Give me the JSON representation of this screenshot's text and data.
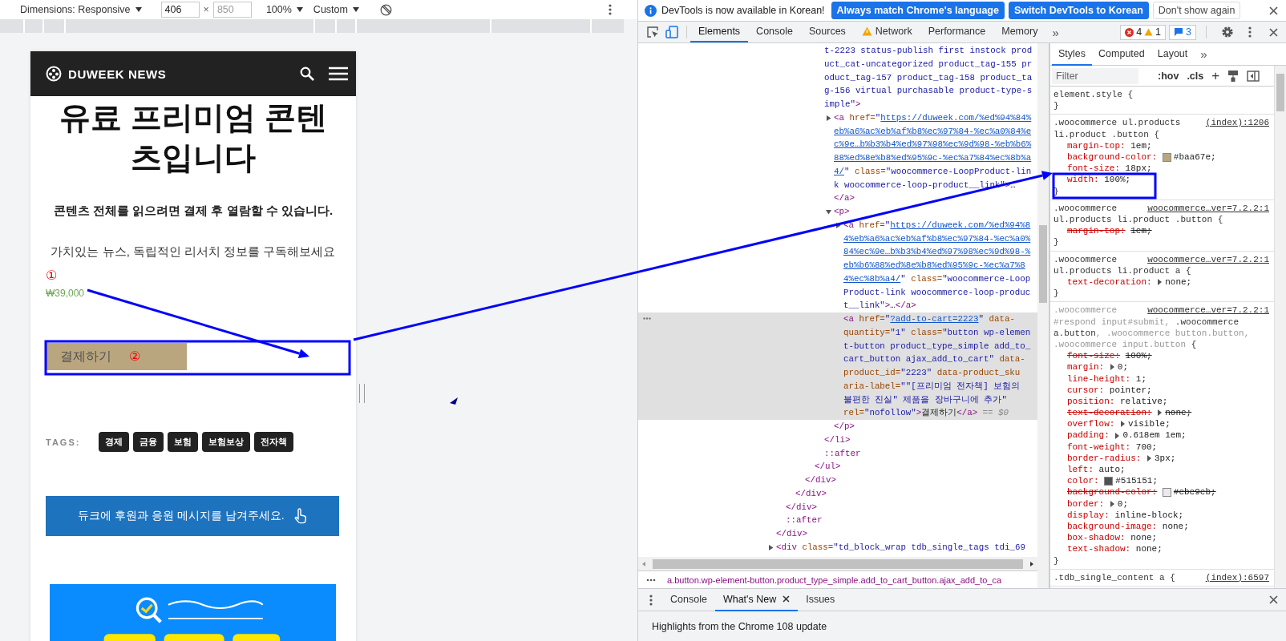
{
  "device_toolbar": {
    "dimensions_label": "Dimensions: Responsive",
    "width_value": "406",
    "times": "×",
    "height_placeholder": "850",
    "zoom": "100%",
    "throttle": "Custom"
  },
  "mobile_page": {
    "brand": "DUWEEK NEWS",
    "title": "유료 프리미엄 콘텐츠입니다",
    "notice": "콘텐츠 전체를 읽으려면 결제 후 열람할 수 있습니다.",
    "subscribe_text": "가치있는 뉴스, 독립적인 리서치 정보를 구독해보세요",
    "price_marker": "①",
    "price": "₩39,000",
    "buy_button": "결제하기",
    "buy_marker": "②",
    "tags_label": "TAGS:",
    "tags": [
      "경제",
      "금융",
      "보험",
      "보험보상",
      "전자책"
    ],
    "support_button": "듀크에 후원과 응원 메시지를 남겨주세요.",
    "banner": {
      "kind": "picture"
    }
  },
  "devtools": {
    "infobar": {
      "message": "DevTools is now available in Korean!",
      "buttons": [
        {
          "label": "Always match Chrome's language",
          "kind": "primary"
        },
        {
          "label": "Switch DevTools to Korean",
          "kind": "primary"
        },
        {
          "label": "Don't show again",
          "kind": "secondary"
        }
      ]
    },
    "device_mode_on": true,
    "tabs": [
      {
        "label": "Elements",
        "selected": true,
        "warning": false
      },
      {
        "label": "Console",
        "selected": false,
        "warning": false
      },
      {
        "label": "Sources",
        "selected": false,
        "warning": false
      },
      {
        "label": "Network",
        "selected": false,
        "warning": true
      },
      {
        "label": "Performance",
        "selected": false,
        "warning": false
      },
      {
        "label": "Memory",
        "selected": false,
        "warning": false
      }
    ],
    "more_tabs": "»",
    "issues": {
      "errors": "4",
      "warnings": "1",
      "messages": "3"
    },
    "dom_tree": [
      {
        "selected": false,
        "children": [
          {
            "selected": false,
            "children": [
              {
                "selected": false,
                "children": [
                  {
                    "selected": false,
                    "children": [
                      {
                        "selected": false,
                        "children": [
                          {
                            "selected": false,
                            "lines": [
                              [
                                {
                                  "kind": "value",
                                  "text": "t-2223 status-publish first instock prod"
                                }
                              ],
                              [
                                {
                                  "kind": "value",
                                  "text": "uct_cat-uncategorized product_tag-155 pr"
                                }
                              ],
                              [
                                {
                                  "kind": "value",
                                  "text": "oduct_tag-157 product_tag-158 product_ta"
                                }
                              ],
                              [
                                {
                                  "kind": "value",
                                  "text": "g-156 virtual purchasable product-type-s"
                                }
                              ],
                              [
                                {
                                  "kind": "value",
                                  "text": "imple\""
                                },
                                {
                                  "kind": "tag",
                                  "text": ">"
                                }
                              ]
                            ],
                            "children": [
                              {
                                "selected": false,
                                "expanded": false,
                                "lines": [
                                  [
                                    {
                                      "kind": "tag",
                                      "text": "<a"
                                    },
                                    {
                                      "kind": "attr",
                                      "text": " href="
                                    },
                                    {
                                      "kind": "value",
                                      "text": "\""
                                    },
                                    {
                                      "kind": "link",
                                      "text": "https://duweek.com/%ed%94%84%"
                                    }
                                  ],
                                  [
                                    {
                                      "kind": "link",
                                      "text": "eb%a6%ac%eb%af%b8%ec%97%84-%ec%a0%84%e"
                                    }
                                  ],
                                  [
                                    {
                                      "kind": "link",
                                      "text": "c%9e…b%b3%b4%ed%97%98%ec%9d%98-%eb%b6%"
                                    }
                                  ],
                                  [
                                    {
                                      "kind": "link",
                                      "text": "88%ed%8e%b8%ed%95%9c-%ec%a7%84%ec%8b%a"
                                    }
                                  ],
                                  [
                                    {
                                      "kind": "link",
                                      "text": "4/"
                                    },
                                    {
                                      "kind": "value",
                                      "text": "\""
                                    },
                                    {
                                      "kind": "attr",
                                      "text": " class="
                                    },
                                    {
                                      "kind": "value",
                                      "text": "\"woocommerce-LoopProduct-lin"
                                    }
                                  ],
                                  [
                                    {
                                      "kind": "value",
                                      "text": "k woocommerce-loop-product__link\""
                                    },
                                    {
                                      "kind": "tag",
                                      "text": ">"
                                    },
                                    {
                                      "kind": "text",
                                      "text": "…"
                                    }
                                  ]
                                ],
                                "close": [
                                  {
                                    "kind": "tag",
                                    "text": "</a>"
                                  }
                                ]
                              },
                              {
                                "selected": false,
                                "expanded": true,
                                "lines": [
                                  [
                                    {
                                      "kind": "tag",
                                      "text": "<p>"
                                    }
                                  ]
                                ],
                                "children": [
                                  {
                                    "selected": false,
                                    "expanded": false,
                                    "lines": [
                                      [
                                        {
                                          "kind": "tag",
                                          "text": "<a"
                                        },
                                        {
                                          "kind": "attr",
                                          "text": " href="
                                        },
                                        {
                                          "kind": "value",
                                          "text": "\""
                                        },
                                        {
                                          "kind": "link",
                                          "text": "https://duweek.com/%ed%94%8"
                                        }
                                      ],
                                      [
                                        {
                                          "kind": "link",
                                          "text": "4%eb%a6%ac%eb%af%b8%ec%97%84-%ec%a0%"
                                        }
                                      ],
                                      [
                                        {
                                          "kind": "link",
                                          "text": "84%ec%9e…b%b3%b4%ed%97%98%ec%9d%98-%"
                                        }
                                      ],
                                      [
                                        {
                                          "kind": "link",
                                          "text": "eb%b6%88%ed%8e%b8%ed%95%9c-%ec%a7%8"
                                        }
                                      ],
                                      [
                                        {
                                          "kind": "link",
                                          "text": "4%ec%8b%a4/"
                                        },
                                        {
                                          "kind": "value",
                                          "text": "\""
                                        },
                                        {
                                          "kind": "attr",
                                          "text": " class="
                                        },
                                        {
                                          "kind": "value",
                                          "text": "\"woocommerce-Loop"
                                        }
                                      ],
                                      [
                                        {
                                          "kind": "value",
                                          "text": "Product-link woocommerce-loop-produc"
                                        }
                                      ],
                                      [
                                        {
                                          "kind": "value",
                                          "text": "t__link\""
                                        },
                                        {
                                          "kind": "tag",
                                          "text": ">"
                                        },
                                        {
                                          "kind": "text",
                                          "text": "…"
                                        },
                                        {
                                          "kind": "tag",
                                          "text": "</a>"
                                        }
                                      ]
                                    ]
                                  },
                                  {
                                    "selected": true,
                                    "lines": [
                                      [
                                        {
                                          "kind": "tag",
                                          "text": "<a"
                                        },
                                        {
                                          "kind": "attr",
                                          "text": " href="
                                        },
                                        {
                                          "kind": "value",
                                          "text": "\""
                                        },
                                        {
                                          "kind": "link",
                                          "text": "?add-to-cart=2223"
                                        },
                                        {
                                          "kind": "value",
                                          "text": "\""
                                        },
                                        {
                                          "kind": "attr",
                                          "text": " data-"
                                        }
                                      ],
                                      [
                                        {
                                          "kind": "attr",
                                          "text": "quantity="
                                        },
                                        {
                                          "kind": "value",
                                          "text": "\"1\""
                                        },
                                        {
                                          "kind": "attr",
                                          "text": " class="
                                        },
                                        {
                                          "kind": "value",
                                          "text": "\"button wp-elemen"
                                        }
                                      ],
                                      [
                                        {
                                          "kind": "value",
                                          "text": "t-button product_type_simple add_to_"
                                        }
                                      ],
                                      [
                                        {
                                          "kind": "value",
                                          "text": "cart_button ajax_add_to_cart\""
                                        },
                                        {
                                          "kind": "attr",
                                          "text": " data-"
                                        }
                                      ],
                                      [
                                        {
                                          "kind": "attr",
                                          "text": "product_id="
                                        },
                                        {
                                          "kind": "value",
                                          "text": "\"2223\""
                                        },
                                        {
                                          "kind": "attr",
                                          "text": " data-product_sku"
                                        }
                                      ],
                                      [
                                        {
                                          "kind": "attr",
                                          "text": "aria-label="
                                        },
                                        {
                                          "kind": "value",
                                          "text": "\"\"[프리미엄 전자책] 보험의"
                                        }
                                      ],
                                      [
                                        {
                                          "kind": "value",
                                          "text": "불편한 진실\" 제품을 장바구니에 추가\""
                                        }
                                      ],
                                      [
                                        {
                                          "kind": "attr",
                                          "text": "rel="
                                        },
                                        {
                                          "kind": "value",
                                          "text": "\"nofollow\""
                                        },
                                        {
                                          "kind": "tag",
                                          "text": ">"
                                        },
                                        {
                                          "kind": "text",
                                          "text": "결제하기"
                                        },
                                        {
                                          "kind": "tag",
                                          "text": "</a>"
                                        },
                                        {
                                          "kind": "comment",
                                          "text": " == $0"
                                        }
                                      ]
                                    ]
                                  }
                                ],
                                "close": [
                                  {
                                    "kind": "tag",
                                    "text": "</p>"
                                  }
                                ]
                              }
                            ],
                            "close": [
                              {
                                "kind": "tag",
                                "text": "</li>"
                              }
                            ]
                          },
                          {
                            "selected": false,
                            "lines": [
                              [
                                {
                                  "kind": "pseudo",
                                  "text": "::after"
                                }
                              ]
                            ]
                          }
                        ],
                        "close": [
                          {
                            "kind": "tag",
                            "text": "</ul>"
                          }
                        ]
                      }
                    ],
                    "close": [
                      {
                        "kind": "tag",
                        "text": "</div>"
                      }
                    ]
                  }
                ],
                "close": [
                  {
                    "kind": "tag",
                    "text": "</div>"
                  }
                ]
              }
            ],
            "close": [
              {
                "kind": "tag",
                "text": "</div>"
              }
            ]
          },
          {
            "selected": false,
            "lines": [
              [
                {
                  "kind": "pseudo",
                  "text": "::after"
                }
              ]
            ]
          }
        ],
        "close": [
          {
            "kind": "tag",
            "text": "</div>"
          }
        ]
      },
      {
        "selected": false,
        "expanded": false,
        "lines": [
          [
            {
              "kind": "tag",
              "text": "<div"
            },
            {
              "kind": "attr",
              "text": " class="
            },
            {
              "kind": "value",
              "text": "\"td_block_wrap tdb_single_tags tdi_69"
            }
          ]
        ]
      }
    ],
    "breadcrumb": {
      "path": "a.button.wp-element-button.product_type_simple.add_to_cart_button.ajax_add_to_ca"
    },
    "styles": {
      "tabs": [
        {
          "label": "Styles",
          "selected": true
        },
        {
          "label": "Computed",
          "selected": false
        },
        {
          "label": "Layout",
          "selected": false
        }
      ],
      "more_tabs": "»",
      "filter_placeholder": "Filter",
      "hov": ":hov",
      "cls": ".cls",
      "add": "+",
      "rules": [
        {
          "selector": [
            [
              {
                "text": "element.style {",
                "matched": true
              }
            ]
          ],
          "close": "}"
        },
        {
          "selector": [
            [
              {
                "text": ".woocommerce ul.products",
                "matched": true
              }
            ],
            [
              {
                "text": "li.product .button {",
                "matched": true
              }
            ]
          ],
          "source": "(index):1206",
          "props": [
            {
              "name": "margin-top:",
              "value": "1em;",
              "struck": false,
              "expandable": false
            },
            {
              "name": "background-color:",
              "value": "#baa67e;",
              "struck": false,
              "expandable": false,
              "color": "#baa67e"
            },
            {
              "name": "font-size:",
              "value": "18px;",
              "struck": false,
              "expandable": false
            },
            {
              "name": "width:",
              "value": "100%;",
              "struck": false,
              "expandable": false
            }
          ],
          "close": "}"
        },
        {
          "selector": [
            [
              {
                "text": ".woocommerce",
                "matched": true
              }
            ],
            [
              {
                "text": "ul.products li.product .button {",
                "matched": true
              }
            ]
          ],
          "source": "woocommerce…ver=7.2.2:1",
          "props": [
            {
              "name": "margin-top:",
              "value": "1em;",
              "struck": true,
              "expandable": false
            }
          ],
          "close": "}"
        },
        {
          "selector": [
            [
              {
                "text": ".woocommerce",
                "matched": true
              }
            ],
            [
              {
                "text": "ul.products li.product a {",
                "matched": true
              }
            ]
          ],
          "source": "woocommerce…ver=7.2.2:1",
          "props": [
            {
              "name": "text-decoration:",
              "value": "none;",
              "struck": false,
              "expandable": true
            }
          ],
          "close": "}"
        },
        {
          "selector": [
            [
              {
                "text": ".woocommerce",
                "matched": false
              }
            ],
            [
              {
                "text": "#respond input#submit, ",
                "matched": false
              },
              {
                "text": ".woocommerce",
                "matched": true
              }
            ],
            [
              {
                "text": "a.button",
                "matched": true
              },
              {
                "text": ", .woocommerce button.button,",
                "matched": false
              }
            ],
            [
              {
                "text": ".woocommerce input.button",
                "matched": false
              },
              {
                "text": " {",
                "matched": true
              }
            ]
          ],
          "source": "woocommerce…ver=7.2.2:1",
          "props": [
            {
              "name": "font-size:",
              "value": "100%;",
              "struck": true,
              "expandable": false
            },
            {
              "name": "margin:",
              "value": "0;",
              "struck": false,
              "expandable": true
            },
            {
              "name": "line-height:",
              "value": "1;",
              "struck": false,
              "expandable": false
            },
            {
              "name": "cursor:",
              "value": "pointer;",
              "struck": false,
              "expandable": false
            },
            {
              "name": "position:",
              "value": "relative;",
              "struck": false,
              "expandable": false
            },
            {
              "name": "text-decoration:",
              "value": "none;",
              "struck": true,
              "expandable": true
            },
            {
              "name": "overflow:",
              "value": "visible;",
              "struck": false,
              "expandable": true
            },
            {
              "name": "padding:",
              "value": "0.618em 1em;",
              "struck": false,
              "expandable": true
            },
            {
              "name": "font-weight:",
              "value": "700;",
              "struck": false,
              "expandable": false
            },
            {
              "name": "border-radius:",
              "value": "3px;",
              "struck": false,
              "expandable": true
            },
            {
              "name": "left:",
              "value": "auto;",
              "struck": false,
              "expandable": false
            },
            {
              "name": "color:",
              "value": "#515151;",
              "struck": false,
              "expandable": false,
              "color": "#515151"
            },
            {
              "name": "background-color:",
              "value": "#ebe9eb;",
              "struck": true,
              "expandable": false,
              "color": "#ebe9eb"
            },
            {
              "name": "border:",
              "value": "0;",
              "struck": false,
              "expandable": true
            },
            {
              "name": "display:",
              "value": "inline-block;",
              "struck": false,
              "expandable": false
            },
            {
              "name": "background-image:",
              "value": "none;",
              "struck": false,
              "expandable": false
            },
            {
              "name": "box-shadow:",
              "value": "none;",
              "struck": false,
              "expandable": false
            },
            {
              "name": "text-shadow:",
              "value": "none;",
              "struck": false,
              "expandable": false
            }
          ],
          "close": "}"
        },
        {
          "selector": [
            [
              {
                "text": ".tdb_single_content a {",
                "matched": true
              }
            ]
          ],
          "source": "(index):6597"
        }
      ]
    },
    "drawer": {
      "tabs": [
        {
          "label": "Console",
          "selected": false,
          "closable": false
        },
        {
          "label": "What's New",
          "selected": true,
          "closable": true
        },
        {
          "label": "Issues",
          "selected": false,
          "closable": false
        }
      ],
      "content": "Highlights from the Chrome 108 update"
    }
  },
  "annotations": [
    {
      "kind": "arrow"
    },
    {
      "kind": "box"
    },
    {
      "kind": "arrow"
    },
    {
      "kind": "box"
    },
    {
      "kind": "mark"
    }
  ]
}
